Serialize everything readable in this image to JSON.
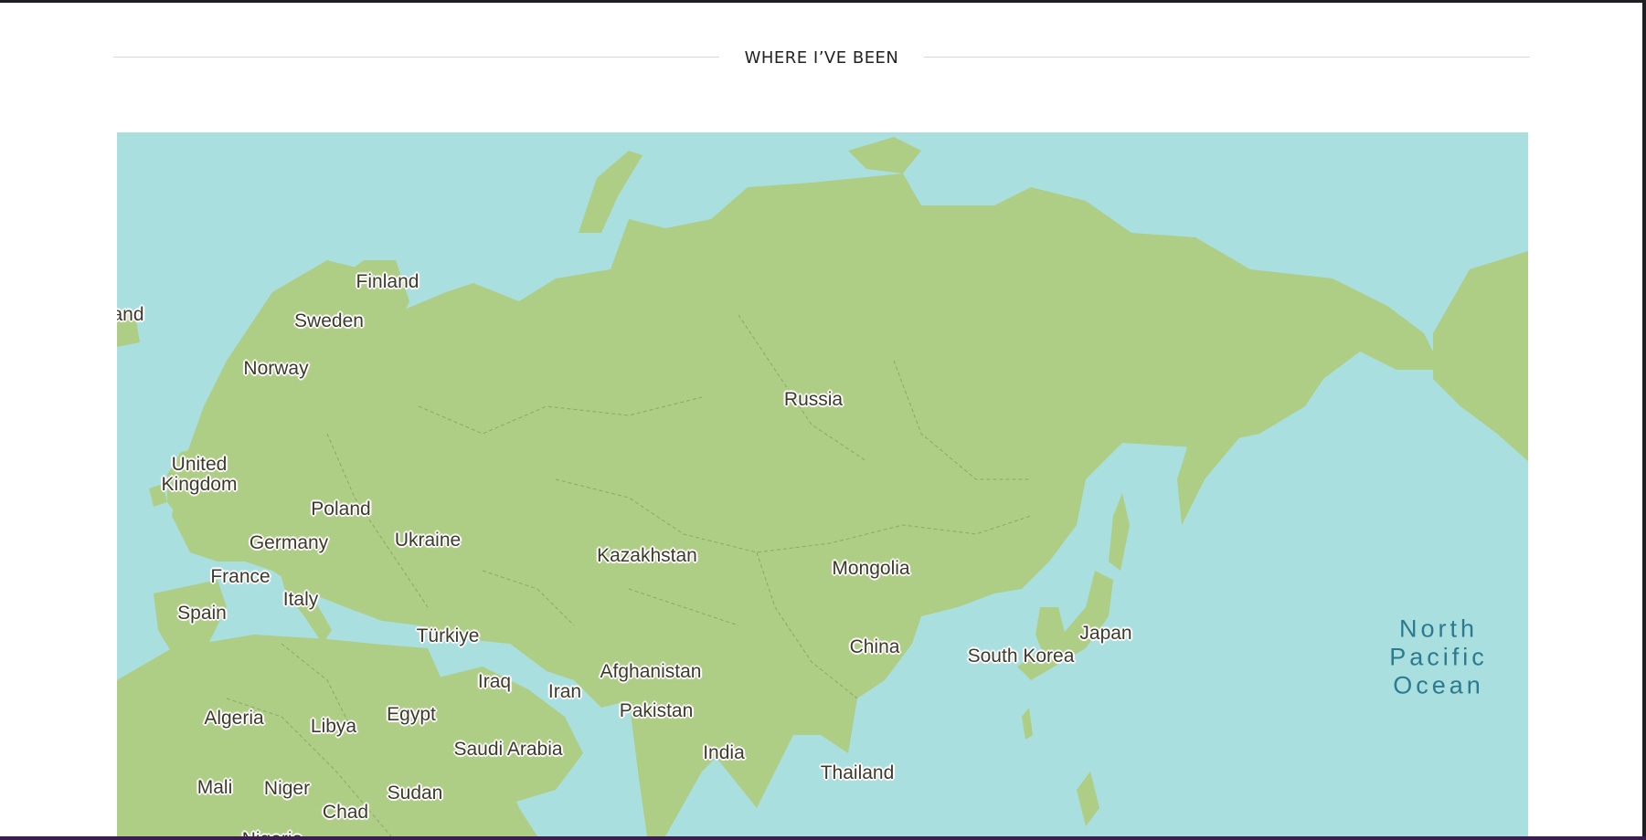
{
  "section": {
    "title": "WHERE I’VE BEEN"
  },
  "map": {
    "land_color": "#aecd85",
    "water_color": "#aadfe0",
    "border_color": "#8aa86a",
    "countries": [
      {
        "key": "iceland",
        "label": "and"
      },
      {
        "key": "finland",
        "label": "Finland"
      },
      {
        "key": "sweden",
        "label": "Sweden"
      },
      {
        "key": "norway",
        "label": "Norway"
      },
      {
        "key": "united-kingdom",
        "label": "United\nKingdom"
      },
      {
        "key": "poland",
        "label": "Poland"
      },
      {
        "key": "germany",
        "label": "Germany"
      },
      {
        "key": "ukraine",
        "label": "Ukraine"
      },
      {
        "key": "france",
        "label": "France"
      },
      {
        "key": "italy",
        "label": "Italy"
      },
      {
        "key": "spain",
        "label": "Spain"
      },
      {
        "key": "turkiye",
        "label": "Türkiye"
      },
      {
        "key": "russia",
        "label": "Russia"
      },
      {
        "key": "kazakhstan",
        "label": "Kazakhstan"
      },
      {
        "key": "mongolia",
        "label": "Mongolia"
      },
      {
        "key": "china",
        "label": "China"
      },
      {
        "key": "south-korea",
        "label": "South Korea"
      },
      {
        "key": "japan",
        "label": "Japan"
      },
      {
        "key": "afghanistan",
        "label": "Afghanistan"
      },
      {
        "key": "pakistan",
        "label": "Pakistan"
      },
      {
        "key": "iraq",
        "label": "Iraq"
      },
      {
        "key": "iran",
        "label": "Iran"
      },
      {
        "key": "india",
        "label": "India"
      },
      {
        "key": "thailand",
        "label": "Thailand"
      },
      {
        "key": "algeria",
        "label": "Algeria"
      },
      {
        "key": "libya",
        "label": "Libya"
      },
      {
        "key": "egypt",
        "label": "Egypt"
      },
      {
        "key": "saudi-arabia",
        "label": "Saudi Arabia"
      },
      {
        "key": "mali",
        "label": "Mali"
      },
      {
        "key": "niger",
        "label": "Niger"
      },
      {
        "key": "sudan",
        "label": "Sudan"
      },
      {
        "key": "chad",
        "label": "Chad"
      },
      {
        "key": "nigeria",
        "label": "Nigeria"
      }
    ],
    "ocean_label": "North\nPacific\nOcean"
  }
}
